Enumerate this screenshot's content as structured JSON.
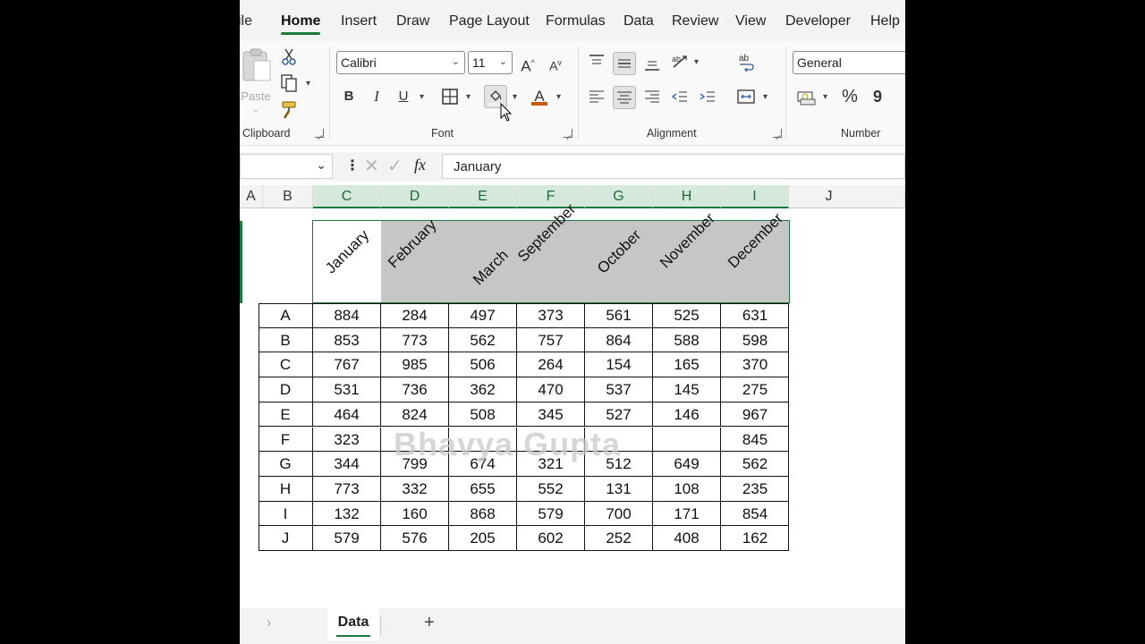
{
  "ribbon_tabs": [
    "ile",
    "Home",
    "Insert",
    "Draw",
    "Page Layout",
    "Formulas",
    "Data",
    "Review",
    "View",
    "Developer",
    "Help"
  ],
  "active_tab": "Home",
  "clipboard": {
    "paste_label": "Paste",
    "group_label": "Clipboard"
  },
  "font": {
    "name": "Calibri",
    "size": "11",
    "group_label": "Font",
    "bold": "B",
    "italic": "I",
    "underline": "U",
    "font_color_letter": "A",
    "grow": "A",
    "shrink": "A"
  },
  "alignment": {
    "group_label": "Alignment"
  },
  "number": {
    "format": "General",
    "group_label": "Number",
    "percent": "%",
    "comma": "9"
  },
  "formula_bar": {
    "fx": "fx",
    "value": "January"
  },
  "columns": [
    "A",
    "B",
    "C",
    "D",
    "E",
    "F",
    "G",
    "H",
    "I",
    "J"
  ],
  "months": [
    "January",
    "February",
    "March",
    "September",
    "October",
    "November",
    "December"
  ],
  "rows": [
    {
      "label": "A",
      "values": [
        "884",
        "284",
        "497",
        "373",
        "561",
        "525",
        "631"
      ]
    },
    {
      "label": "B",
      "values": [
        "853",
        "773",
        "562",
        "757",
        "864",
        "588",
        "598"
      ]
    },
    {
      "label": "C",
      "values": [
        "767",
        "985",
        "506",
        "264",
        "154",
        "165",
        "370"
      ]
    },
    {
      "label": "D",
      "values": [
        "531",
        "736",
        "362",
        "470",
        "537",
        "145",
        "275"
      ]
    },
    {
      "label": "E",
      "values": [
        "464",
        "824",
        "508",
        "345",
        "527",
        "146",
        "967"
      ]
    },
    {
      "label": "F",
      "values": [
        "323",
        "",
        "",
        "",
        "",
        "",
        "845"
      ]
    },
    {
      "label": "G",
      "values": [
        "344",
        "799",
        "674",
        "321",
        "512",
        "649",
        "562"
      ]
    },
    {
      "label": "H",
      "values": [
        "773",
        "332",
        "655",
        "552",
        "131",
        "108",
        "235"
      ]
    },
    {
      "label": "I",
      "values": [
        "132",
        "160",
        "868",
        "579",
        "700",
        "171",
        "854"
      ]
    },
    {
      "label": "J",
      "values": [
        "579",
        "576",
        "205",
        "602",
        "252",
        "408",
        "162"
      ]
    }
  ],
  "watermark": "Bhavya Gupta",
  "sheet": {
    "name": "Data",
    "add": "+"
  },
  "colors": {
    "accent": "#1b7a3e",
    "header_fill": "#c6c6c6",
    "font_color_bar": "#c55a11"
  }
}
